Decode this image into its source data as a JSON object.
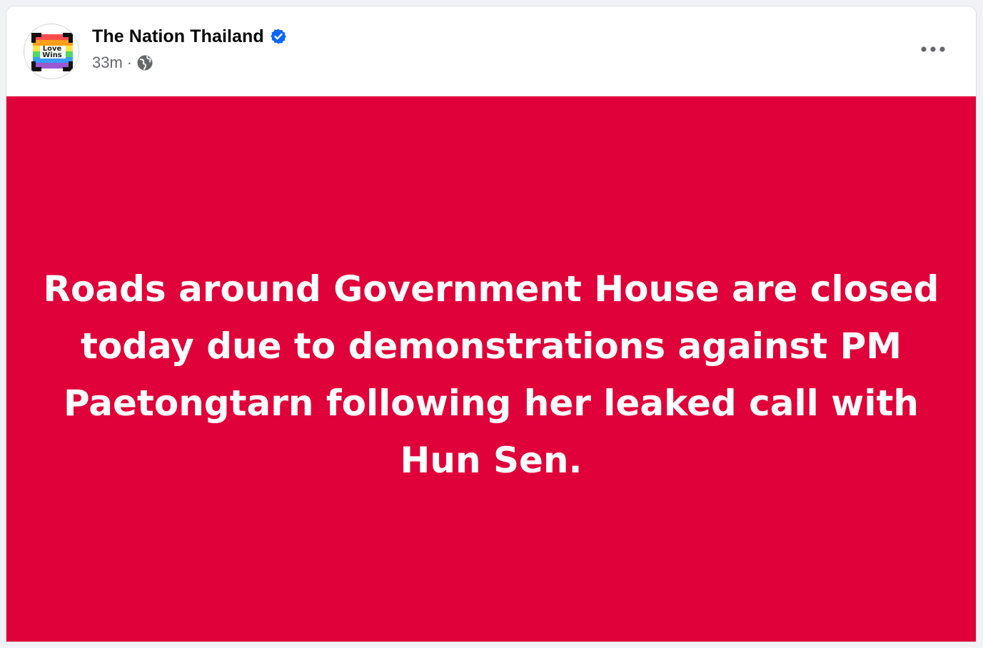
{
  "post": {
    "author": {
      "name": "The Nation Thailand",
      "avatar_logo_text": "Love Wins",
      "verified": true,
      "verified_icon": "verified-badge-icon",
      "verified_color": "#0866ff"
    },
    "meta": {
      "timestamp": "33m",
      "separator": "·",
      "audience_icon": "globe-icon"
    },
    "menu_icon": "more-options-icon",
    "media": {
      "background_color": "#e0003a",
      "text_color": "#ffffff",
      "text": "Roads around Government House are closed today due to demonstrations against PM Paetongtarn following her leaked call with Hun Sen."
    }
  }
}
